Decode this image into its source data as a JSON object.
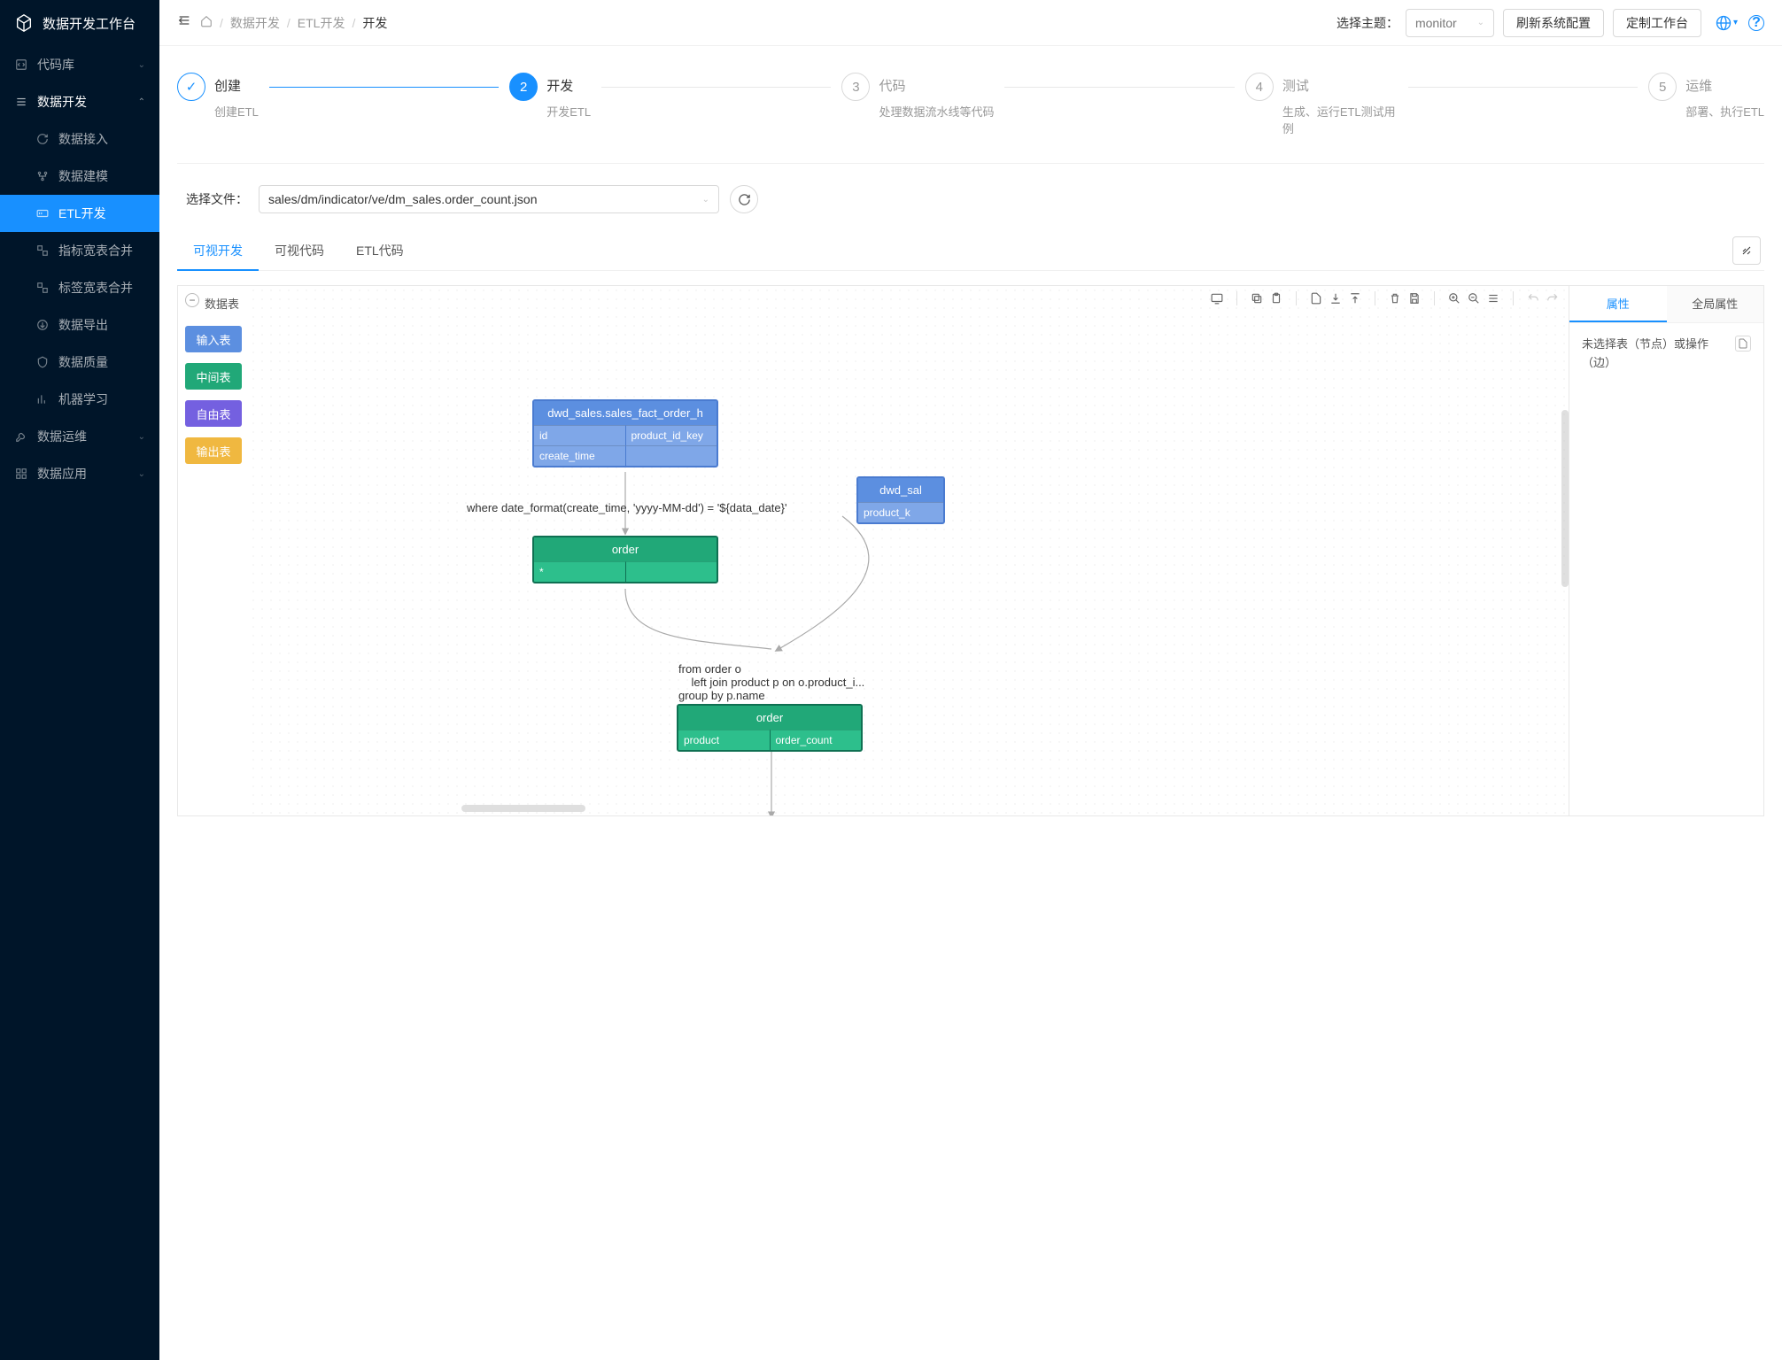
{
  "app": {
    "title": "数据开发工作台"
  },
  "sidebar": {
    "items": [
      {
        "label": "代码库",
        "icon": "code"
      },
      {
        "label": "数据开发",
        "icon": "dev",
        "open": true,
        "children": [
          {
            "label": "数据接入",
            "icon": "sync"
          },
          {
            "label": "数据建模",
            "icon": "model"
          },
          {
            "label": "ETL开发",
            "icon": "etl",
            "active": true
          },
          {
            "label": "指标宽表合并",
            "icon": "merge"
          },
          {
            "label": "标签宽表合并",
            "icon": "merge"
          },
          {
            "label": "数据导出",
            "icon": "export"
          },
          {
            "label": "数据质量",
            "icon": "quality"
          },
          {
            "label": "机器学习",
            "icon": "ml"
          }
        ]
      },
      {
        "label": "数据运维",
        "icon": "ops"
      },
      {
        "label": "数据应用",
        "icon": "app"
      }
    ]
  },
  "breadcrumb": {
    "items": [
      "数据开发",
      "ETL开发",
      "开发"
    ]
  },
  "topbar": {
    "theme_label": "选择主题：",
    "theme_value": "monitor",
    "refresh_btn": "刷新系统配置",
    "customize_btn": "定制工作台"
  },
  "steps": [
    {
      "num": "✓",
      "title": "创建",
      "desc": "创建ETL",
      "state": "done"
    },
    {
      "num": "2",
      "title": "开发",
      "desc": "开发ETL",
      "state": "active"
    },
    {
      "num": "3",
      "title": "代码",
      "desc": "处理数据流水线等代码",
      "state": "wait"
    },
    {
      "num": "4",
      "title": "测试",
      "desc": "生成、运行ETL测试用例",
      "state": "wait"
    },
    {
      "num": "5",
      "title": "运维",
      "desc": "部署、执行ETL",
      "state": "wait"
    }
  ],
  "file": {
    "label": "选择文件：",
    "value": "sales/dm/indicator/ve/dm_sales.order_count.json"
  },
  "tabs": {
    "items": [
      "可视开发",
      "可视代码",
      "ETL代码"
    ],
    "active": 0
  },
  "palette": {
    "title": "数据表",
    "items": [
      {
        "label": "输入表",
        "color": "#5c8fe0"
      },
      {
        "label": "中间表",
        "color": "#21a878"
      },
      {
        "label": "自由表",
        "color": "#7460e0"
      },
      {
        "label": "输出表",
        "color": "#f0b840"
      }
    ]
  },
  "nodes": {
    "n1": {
      "title": "dwd_sales.sales_fact_order_h",
      "cols_row1": [
        "id",
        "product_id_key"
      ],
      "cols_row2": [
        "create_time",
        ""
      ]
    },
    "n2": {
      "title": "order",
      "cols_row1": [
        "*",
        ""
      ]
    },
    "n3": {
      "title": "order",
      "cols_row1": [
        "product",
        "order_count"
      ]
    },
    "n4": {
      "title": "dwd_sal",
      "cols_row1": [
        "product_k"
      ]
    }
  },
  "edges": {
    "e1_label": "where date_format(create_time, 'yyyy-MM-dd') = '${data_date}'",
    "e2_label": "from order o\n    left join product p on o.product_i...\ngroup by p.name"
  },
  "props": {
    "tabs": [
      "属性",
      "全局属性"
    ],
    "active": 0,
    "empty": "未选择表（节点）或操作（边）"
  }
}
